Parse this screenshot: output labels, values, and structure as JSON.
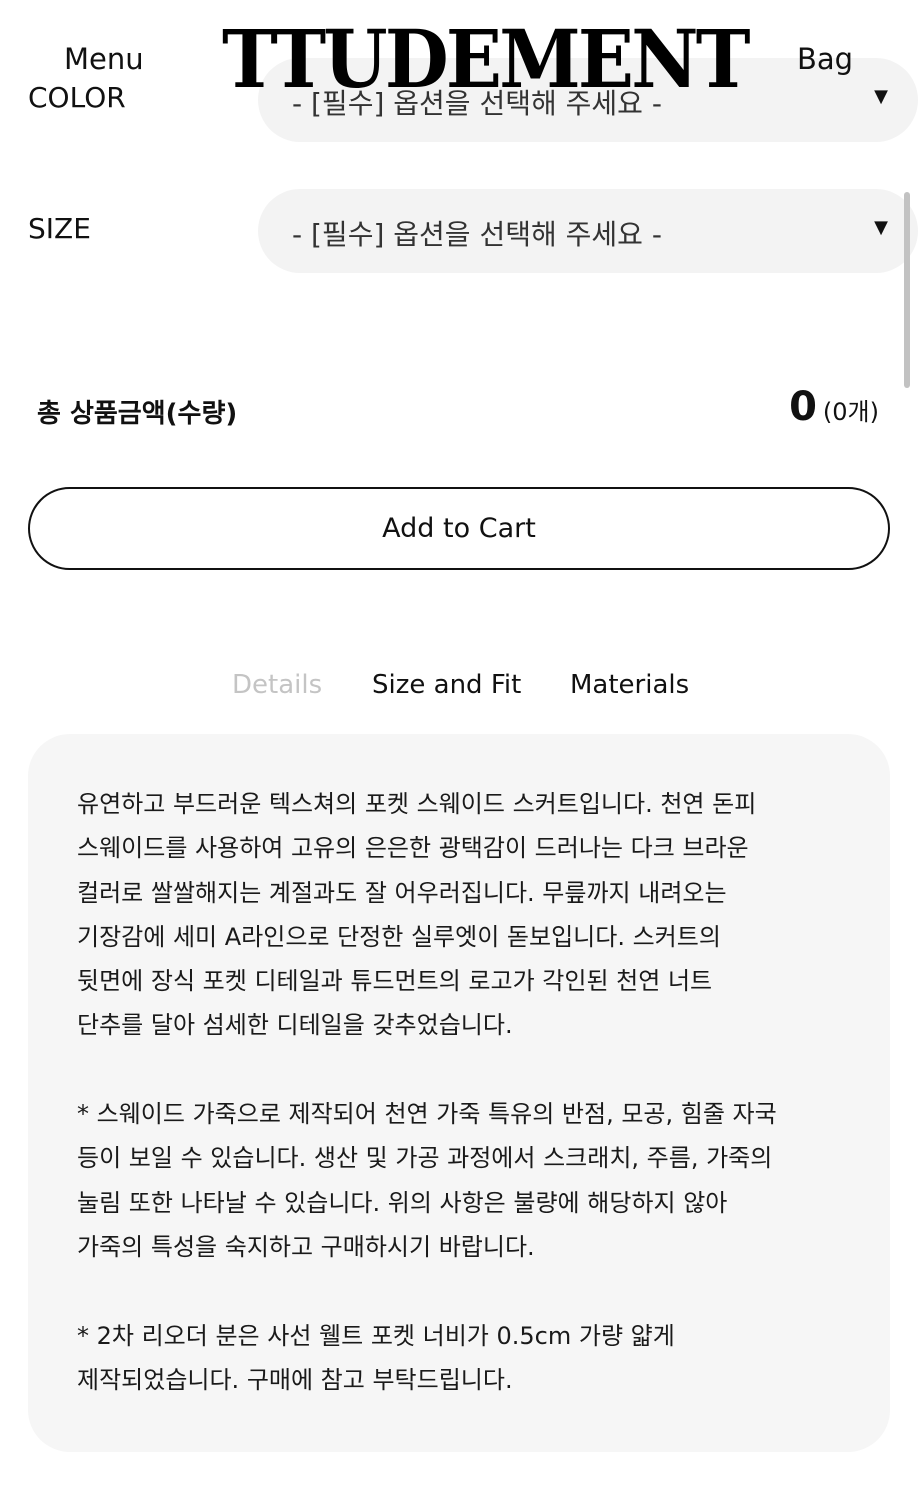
{
  "header": {
    "menu_label": "Menu",
    "logo_text": "TTUDEMENT",
    "bag_label": "Bag"
  },
  "options": {
    "color": {
      "label": "COLOR",
      "placeholder": "- [필수] 옵션을 선택해 주세요 -"
    },
    "size": {
      "label": "SIZE",
      "placeholder": "- [필수] 옵션을 선택해 주세요 -"
    }
  },
  "total": {
    "label": "총 상품금액(수량)",
    "amount": "0",
    "quantity": "(0개)"
  },
  "cart_button_label": "Add to Cart",
  "tabs": [
    {
      "label": "Details",
      "active": true
    },
    {
      "label": "Size and Fit",
      "active": false
    },
    {
      "label": "Materials",
      "active": false
    }
  ],
  "details": {
    "paragraphs": [
      "유연하고 부드러운 텍스쳐의 포켓 스웨이드 스커트입니다. 천연 돈피\n스웨이드를 사용하여 고유의 은은한 광택감이 드러나는 다크 브라운\n컬러로 쌀쌀해지는 계절과도 잘 어우러집니다. 무릎까지 내려오는\n기장감에 세미 A라인으로 단정한 실루엣이 돋보입니다. 스커트의\n뒷면에 장식 포켓 디테일과 튜드먼트의 로고가 각인된 천연 너트\n단추를 달아 섬세한 디테일을 갖추었습니다.",
      "* 스웨이드 가죽으로 제작되어 천연 가죽 특유의 반점, 모공, 힘줄 자국\n등이 보일 수 있습니다. 생산 및 가공 과정에서 스크래치, 주름, 가죽의\n눌림 또한 나타날 수 있습니다. 위의 사항은 불량에 해당하지 않아\n가죽의 특성을 숙지하고 구매하시기 바랍니다.",
      "* 2차 리오더 분은 사선 웰트 포켓 너비가 0.5cm 가량 얇게\n제작되었습니다. 구매에 참고 부탁드립니다."
    ]
  }
}
